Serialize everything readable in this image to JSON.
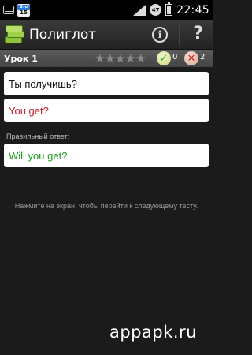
{
  "status_bar": {
    "calendar_top": "Вто",
    "calendar_day": "15",
    "alarm_badge": "47",
    "time": "22:45"
  },
  "action_bar": {
    "title": "Полиглот",
    "info_glyph": "i",
    "help_glyph": "?"
  },
  "lesson_bar": {
    "title": "Урок 1",
    "stars_total": 5,
    "stars_filled": 0,
    "correct_count": "0",
    "wrong_count": "2"
  },
  "exercise": {
    "question": "Ты получишь?",
    "user_answer": "You get?",
    "correct_label": "Правильный ответ:",
    "correct_answer": "Will you get?",
    "hint": "Нажмите на экран, чтобы перейти к следующему тесту."
  },
  "watermark": "appapk.ru",
  "colors": {
    "user_answer": "#c0222e",
    "correct_answer": "#1f9e22",
    "background": "#1b1b1b"
  },
  "icons": {
    "status": [
      "mail-icon",
      "calendar-icon",
      "signal-icon",
      "alarm-icon",
      "battery-icon"
    ],
    "action_bar": [
      "app-logo-icon",
      "info-icon",
      "help-icon"
    ],
    "lesson_bar": [
      "star-icon",
      "check-icon",
      "cross-icon"
    ]
  }
}
